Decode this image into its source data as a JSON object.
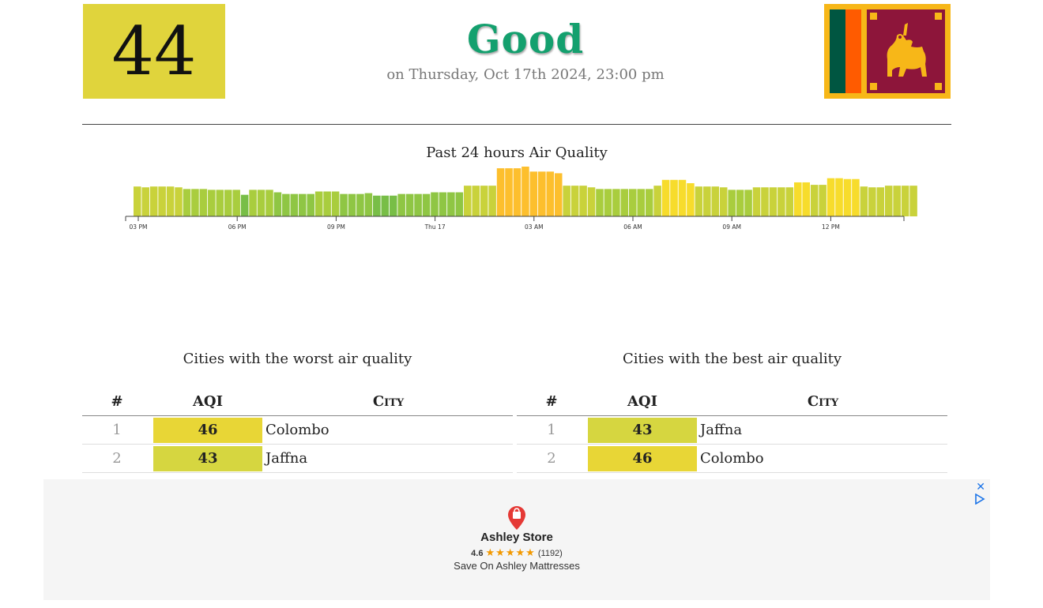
{
  "header": {
    "aqi": "44",
    "status": "Good",
    "timestamp": "on Thursday, Oct 17th 2024, 23:00 pm",
    "aqi_color": "#e0d43c",
    "status_color": "#14a06e"
  },
  "chart_data": {
    "type": "bar",
    "title": "Past 24 hours Air Quality",
    "tick_labels": [
      "03 PM",
      "06 PM",
      "09 PM",
      "Thu 17",
      "03 AM",
      "06 AM",
      "09 AM",
      "12 PM"
    ],
    "values": [
      36,
      35,
      36,
      36,
      36,
      35,
      33,
      33,
      33,
      32,
      32,
      32,
      32,
      26,
      32,
      32,
      32,
      29,
      27,
      27,
      27,
      27,
      30,
      30,
      30,
      27,
      27,
      27,
      28,
      25,
      25,
      25,
      27,
      27,
      27,
      27,
      29,
      29,
      29,
      29,
      37,
      37,
      37,
      37,
      58,
      58,
      58,
      60,
      54,
      54,
      54,
      52,
      37,
      37,
      37,
      35,
      33,
      33,
      33,
      33,
      33,
      33,
      33,
      37,
      44,
      44,
      44,
      40,
      36,
      36,
      36,
      35,
      32,
      32,
      32,
      35,
      35,
      35,
      35,
      35,
      41,
      41,
      38,
      38,
      46,
      46,
      45,
      45,
      36,
      35,
      35,
      37,
      37,
      37,
      37
    ],
    "ylim": [
      0,
      70
    ]
  },
  "worst": {
    "title": "Cities with the worst air quality",
    "headers": {
      "rank": "#",
      "aqi": "AQI",
      "city": "City"
    },
    "rows": [
      {
        "rank": "1",
        "aqi": "46",
        "city": "Colombo",
        "color": "#e8d636"
      },
      {
        "rank": "2",
        "aqi": "43",
        "city": "Jaffna",
        "color": "#d6d640"
      }
    ]
  },
  "best": {
    "title": "Cities with the best air quality",
    "headers": {
      "rank": "#",
      "aqi": "AQI",
      "city": "City"
    },
    "rows": [
      {
        "rank": "1",
        "aqi": "43",
        "city": "Jaffna",
        "color": "#d6d640"
      },
      {
        "rank": "2",
        "aqi": "46",
        "city": "Colombo",
        "color": "#e8d636"
      }
    ]
  },
  "ad": {
    "close": "✕",
    "name": "Ashley Store",
    "rating": "4.6",
    "stars": "★★★★★",
    "reviews": "(1192)",
    "tagline": "Save On Ashley Mattresses"
  }
}
